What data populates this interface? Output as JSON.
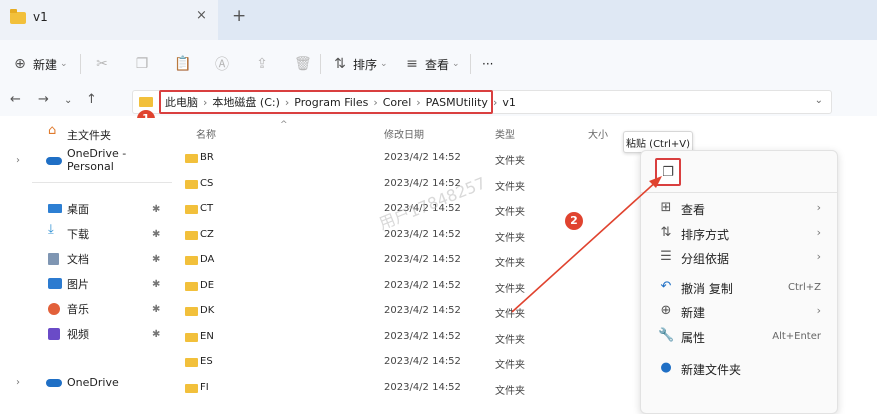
{
  "window": {
    "tab_title": "v1",
    "tab_close": "×",
    "tab_add": "+"
  },
  "toolbar": {
    "new_label": "新建",
    "sort_label": "排序",
    "view_label": "查看",
    "more_label": "···"
  },
  "address": {
    "crumbs": [
      "此电脑",
      "本地磁盘 (C:)",
      "Program Files",
      "Corel",
      "PASMUtility",
      "v1"
    ],
    "separator": "›"
  },
  "nav": {
    "home": "主文件夹",
    "onedrive_personal": "OneDrive - Personal",
    "desktop": "桌面",
    "downloads": "下载",
    "documents": "文档",
    "pictures": "图片",
    "music": "音乐",
    "videos": "视频",
    "onedrive": "OneDrive"
  },
  "columns": {
    "name": "名称",
    "modified": "修改日期",
    "type": "类型",
    "size": "大小"
  },
  "files": [
    {
      "name": "BR",
      "date": "2023/4/2 14:52",
      "type": "文件夹"
    },
    {
      "name": "CS",
      "date": "2023/4/2 14:52",
      "type": "文件夹"
    },
    {
      "name": "CT",
      "date": "2023/4/2 14:52",
      "type": "文件夹"
    },
    {
      "name": "CZ",
      "date": "2023/4/2 14:52",
      "type": "文件夹"
    },
    {
      "name": "DA",
      "date": "2023/4/2 14:52",
      "type": "文件夹"
    },
    {
      "name": "DE",
      "date": "2023/4/2 14:52",
      "type": "文件夹"
    },
    {
      "name": "DK",
      "date": "2023/4/2 14:52",
      "type": "文件夹"
    },
    {
      "name": "EN",
      "date": "2023/4/2 14:52",
      "type": "文件夹"
    },
    {
      "name": "ES",
      "date": "2023/4/2 14:52",
      "type": "文件夹"
    },
    {
      "name": "FI",
      "date": "2023/4/2 14:52",
      "type": "文件夹"
    }
  ],
  "watermark": "用户17848257",
  "context_menu": {
    "paste_tooltip": "粘贴 (Ctrl+V)",
    "view": "查看",
    "sort": "排序方式",
    "group": "分组依据",
    "undo": "撤消 复制",
    "undo_shortcut": "Ctrl+Z",
    "new": "新建",
    "properties": "属性",
    "properties_shortcut": "Alt+Enter",
    "new_folder": "新建文件夹"
  },
  "badges": {
    "one": "1",
    "two": "2"
  },
  "colors": {
    "accent": "#d93f3f",
    "folder": "#f2c03b",
    "titlebar": "#dfe8f4"
  }
}
